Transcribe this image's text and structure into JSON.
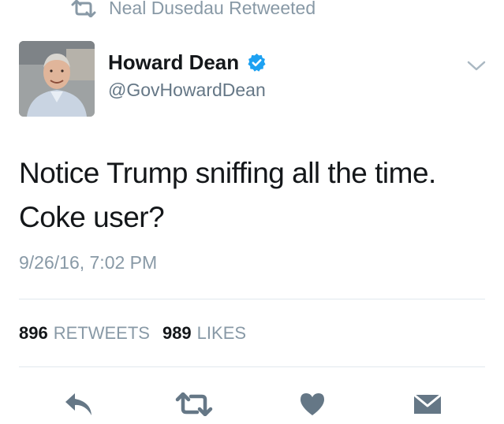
{
  "retweet_context": {
    "text": "Neal Dusedau Retweeted",
    "icon": "retweet-icon"
  },
  "tweet": {
    "author": {
      "name": "Howard Dean",
      "handle": "@GovHowardDean",
      "verified": true
    },
    "text": "Notice Trump sniffing all the time. Coke user?",
    "timestamp": "9/26/16, 7:02 PM",
    "stats": {
      "retweets_count": "896",
      "retweets_label": "RETWEETS",
      "likes_count": "989",
      "likes_label": "LIKES"
    }
  },
  "actions": [
    {
      "name": "reply",
      "icon": "reply-icon"
    },
    {
      "name": "retweet",
      "icon": "retweet-icon"
    },
    {
      "name": "like",
      "icon": "heart-icon"
    },
    {
      "name": "direct-message",
      "icon": "envelope-icon"
    }
  ],
  "colors": {
    "text_primary": "#14171a",
    "text_secondary": "#8899a6",
    "verified_blue": "#1da1f2",
    "action_icon": "#657786",
    "divider": "#e1e8ed"
  }
}
